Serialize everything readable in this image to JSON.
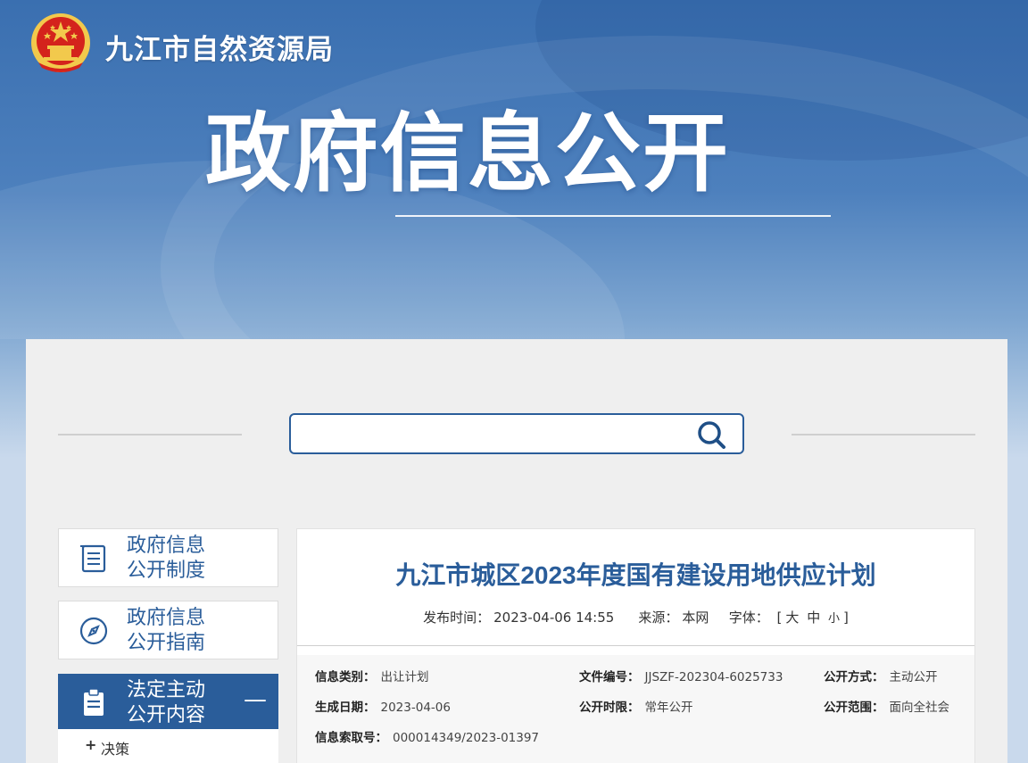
{
  "header": {
    "site_name": "九江市自然资源局",
    "hero_title": "政府信息公开"
  },
  "search": {
    "placeholder": "",
    "icon": "search-icon"
  },
  "sidebar": {
    "items": [
      {
        "label_line1": "政府信息",
        "label_line2": "公开制度",
        "icon": "list-icon"
      },
      {
        "label_line1": "政府信息",
        "label_line2": "公开指南",
        "icon": "compass-icon"
      },
      {
        "label_line1": "法定主动",
        "label_line2": "公开内容",
        "icon": "clipboard-icon",
        "toggle": "—"
      }
    ],
    "sub_items": [
      {
        "prefix": "+",
        "label": "决策"
      }
    ]
  },
  "article": {
    "title": "九江市城区2023年度国有建设用地供应计划",
    "publish_label": "发布时间：",
    "publish_time": "2023-04-06 14:55",
    "source_label": "来源：",
    "source": "本网",
    "font_label": "字体：",
    "font_open": "[",
    "font_large": "大",
    "font_medium": "中",
    "font_small": "小",
    "font_close": "]"
  },
  "info": {
    "category_label": "信息类别：",
    "category": "出让计划",
    "doc_no_label": "文件编号：",
    "doc_no": "JJSZF-202304-6025733",
    "method_label": "公开方式：",
    "method": "主动公开",
    "date_label": "生成日期：",
    "date": "2023-04-06",
    "period_label": "公开时限：",
    "period": "常年公开",
    "scope_label": "公开范围：",
    "scope": "面向全社会",
    "index_label": "信息索取号：",
    "index": "000014349/2023-01397"
  },
  "colors": {
    "primary": "#2a5d9a",
    "panel_bg": "#efefef",
    "emblem_red": "#d4231c",
    "emblem_gold": "#f2c94c"
  }
}
